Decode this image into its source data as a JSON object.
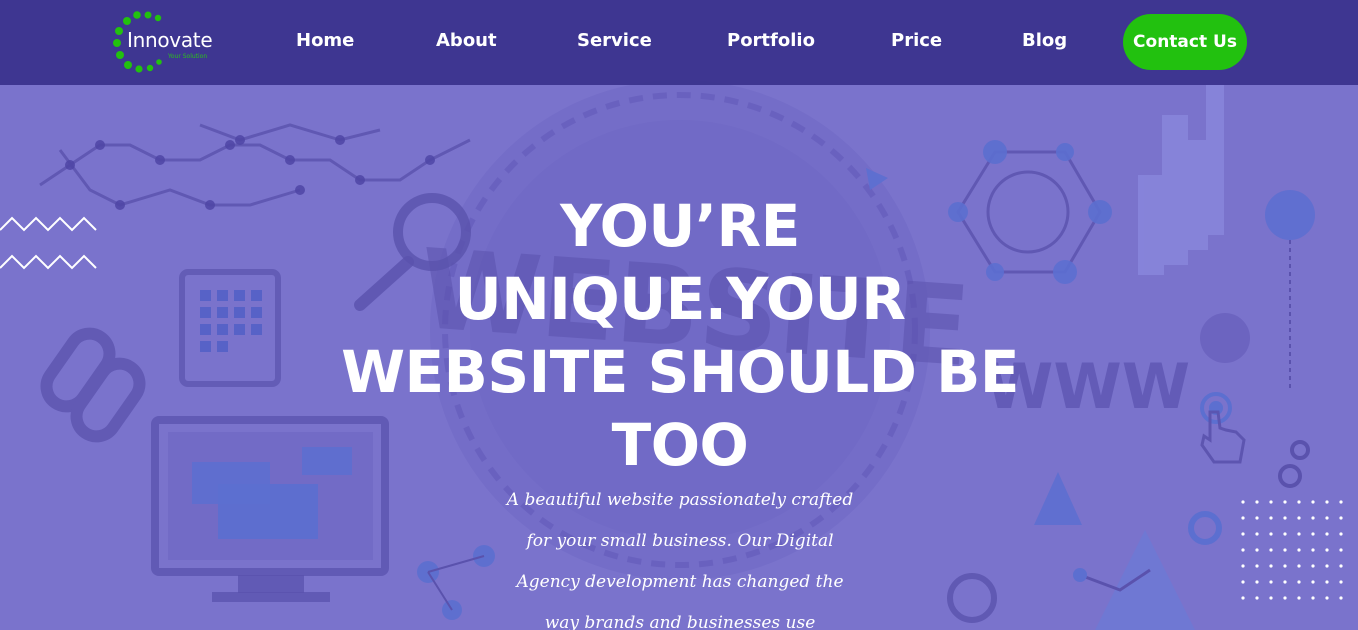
{
  "brand": {
    "name": "Innovate",
    "tagline": "Your Solution",
    "logo_dot_color": "#22c10f"
  },
  "nav": {
    "items": [
      {
        "label": "Home"
      },
      {
        "label": "About"
      },
      {
        "label": "Service"
      },
      {
        "label": "Portfolio"
      },
      {
        "label": "Price"
      },
      {
        "label": "Blog"
      }
    ],
    "cta": {
      "label": "Contact Us"
    }
  },
  "hero": {
    "title_lines": [
      "YOU’RE",
      "UNIQUE.YOUR",
      "WEBSITE SHOULD BE",
      "TOO"
    ],
    "subtitle_lines": [
      "A beautiful website passionately crafted",
      "for your small business. Our Digital",
      "Agency development has changed the",
      "way brands and businesses use"
    ]
  },
  "background": {
    "watermark_word": "WEBSITE",
    "watermark_www": "WWW"
  },
  "colors": {
    "header_bg": "#39328c",
    "page_bg": "#7a73cc",
    "accent": "#22c10f",
    "text": "#ffffff"
  }
}
